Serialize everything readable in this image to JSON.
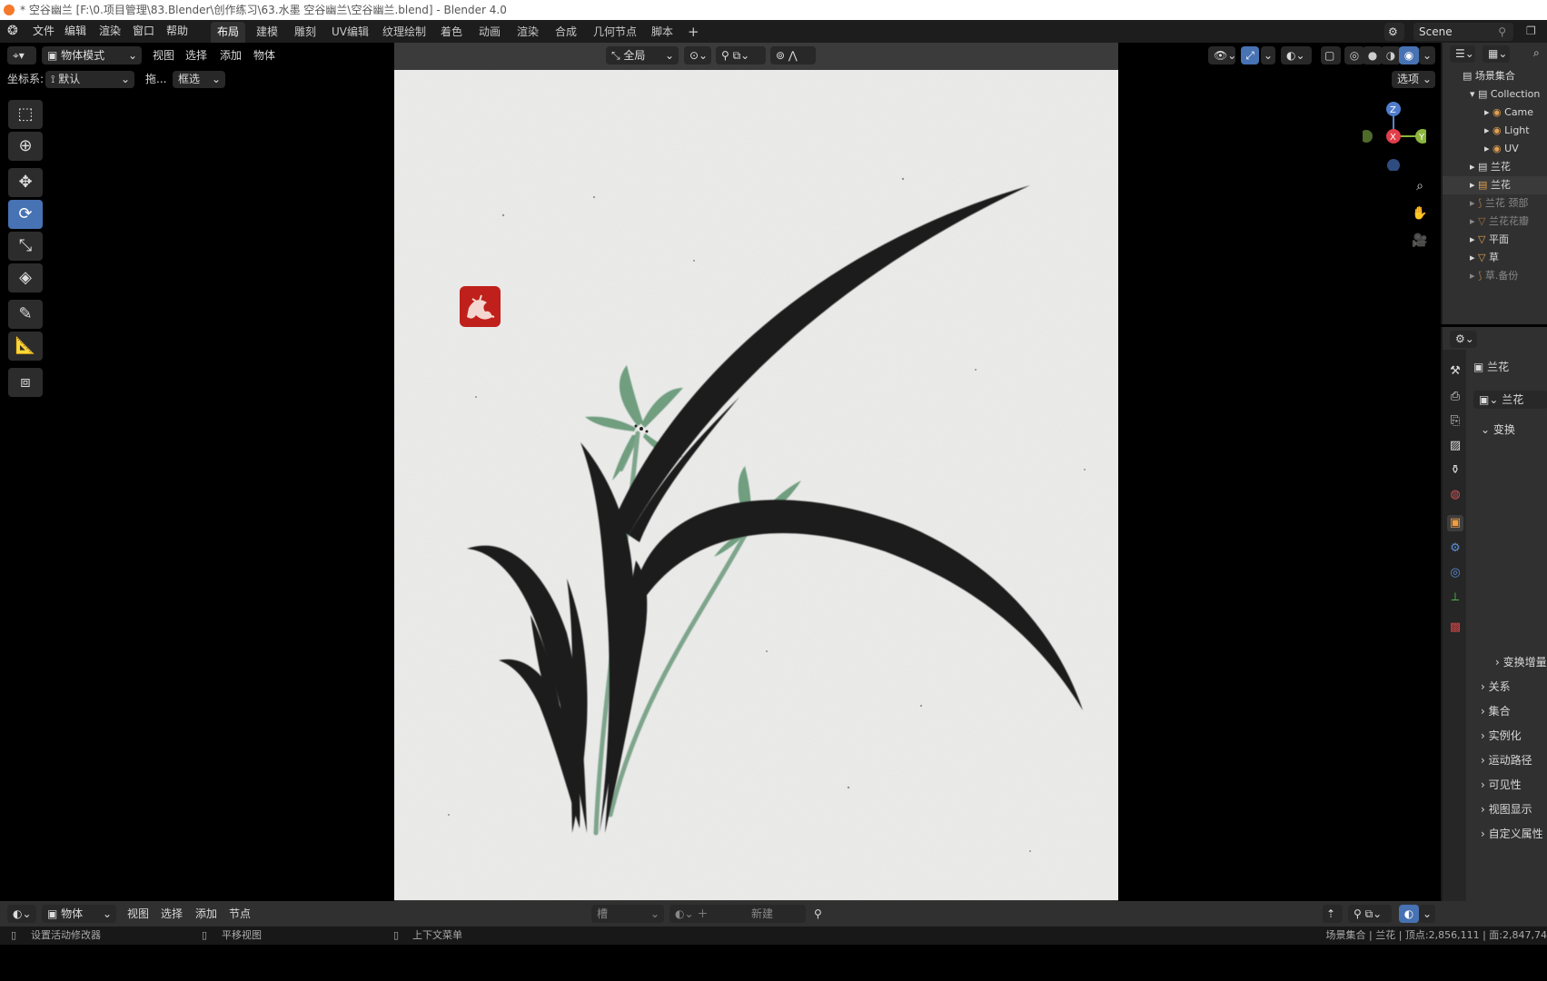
{
  "window": {
    "title": "* 空谷幽兰 [F:\\0.项目管理\\83.Blender\\创作练习\\63.水墨 空谷幽兰\\空谷幽兰.blend] - Blender 4.0"
  },
  "menubar": {
    "items": [
      "文件",
      "编辑",
      "渲染",
      "窗口",
      "帮助"
    ],
    "workspaces": [
      "布局",
      "建模",
      "雕刻",
      "UV编辑",
      "纹理绘制",
      "着色",
      "动画",
      "渲染",
      "合成",
      "几何节点",
      "脚本"
    ],
    "add_tab": "+",
    "scene": "Scene"
  },
  "viewport_header": {
    "mode": "物体模式",
    "menus": [
      "视图",
      "选择",
      "添加",
      "物体"
    ],
    "transform_orientation": "全局",
    "options": "选项",
    "coord_label": "坐标系:",
    "coord_value": "默认",
    "drag_label": "拖...",
    "select_mode": "框选"
  },
  "gizmo": {
    "z": "Z",
    "x": "X",
    "y": "Y"
  },
  "outliner": {
    "root": "场景集合",
    "items": [
      {
        "label": "Collection",
        "indent": 1
      },
      {
        "label": "Came",
        "indent": 2
      },
      {
        "label": "Light",
        "indent": 2
      },
      {
        "label": "UV",
        "indent": 2
      },
      {
        "label": "兰花",
        "indent": 1
      },
      {
        "label": "兰花",
        "indent": 1
      },
      {
        "label": "兰花 颈部",
        "indent": 1
      },
      {
        "label": "兰花花瓣",
        "indent": 1
      },
      {
        "label": "平面",
        "indent": 1
      },
      {
        "label": "草",
        "indent": 1
      },
      {
        "label": "草.备份",
        "indent": 1
      }
    ]
  },
  "properties": {
    "object_name": "兰花",
    "object_field": "兰花",
    "panels": [
      "变换",
      "变换增量",
      "关系",
      "集合",
      "实例化",
      "运动路径",
      "可见性",
      "视图显示",
      "自定义属性"
    ]
  },
  "bottom_editor": {
    "mode": "物体",
    "menus": [
      "视图",
      "选择",
      "添加",
      "节点"
    ],
    "slot": "槽",
    "new_button": "新建"
  },
  "statusbar": {
    "left1": "设置活动修改器",
    "left2": "平移视图",
    "left3": "上下文菜单",
    "right": "场景集合 | 兰花 | 顶点:2,856,111 | 面:2,847,74"
  },
  "colors": {
    "accent": "#4772b3",
    "stamp_red": "#c0201b",
    "ink": "#1a1a1a",
    "petal_green": "#6f9e7f",
    "paper": "#ececec"
  }
}
